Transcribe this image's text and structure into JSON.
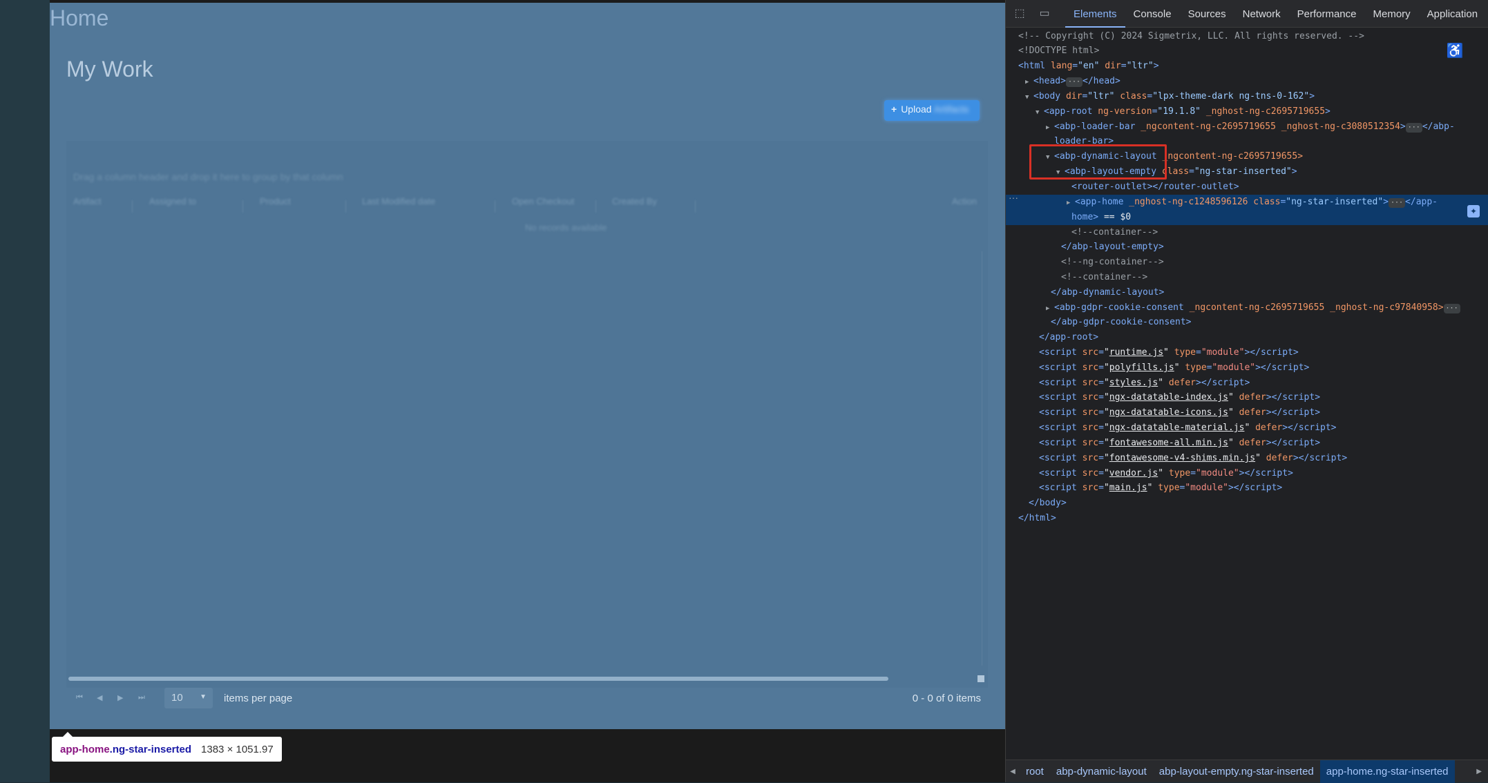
{
  "app": {
    "title": "Home",
    "subtitle": "My Work",
    "upload_label": "Upload",
    "upload_blurred": "Artifacts",
    "hint": "Drag a column header and drop it here to group by that column",
    "columns": [
      "Artifact",
      "Assigned to",
      "Product",
      "Last Modified date",
      "Open Checkout",
      "Created By",
      "Action"
    ],
    "no_records": "No records available",
    "pager": {
      "first_icon": "⏮",
      "prev_icon": "◀",
      "next_icon": "▶",
      "last_icon": "⏭",
      "page_size": "10",
      "items_per_page": "items per page",
      "range": "0 - 0 of 0 items"
    }
  },
  "tooltip": {
    "tag": "app-home",
    "cls": ".ng-star-inserted",
    "size": "1383 × 1051.97"
  },
  "devtools": {
    "tabs": [
      "Elements",
      "Console",
      "Sources",
      "Network",
      "Performance",
      "Memory",
      "Application"
    ],
    "active_tab": "Elements",
    "code": {
      "l1": "<!-- Copyright (C) 2024 Sigmetrix, LLC. All rights reserved. -->",
      "l2": "<!DOCTYPE html>",
      "html_tag": "html",
      "html_lang_attr": "lang",
      "html_lang_val": "\"en\"",
      "html_dir_attr": "dir",
      "html_dir_val": "\"ltr\"",
      "head_open": "<head>",
      "head_close": "</head>",
      "body_dir": "\"ltr\"",
      "body_class": "\"lpx-theme-dark ng-tns-0-162\"",
      "approot_ver": "\"19.1.8\"",
      "approot_host": "_nghost-ng-c2695719655",
      "loader": "<abp-loader-bar",
      "loader_attrs": "_ngcontent-ng-c2695719655 _nghost-ng-c3080512354",
      "loader_close1": "</abp-",
      "loader_close2": "loader-bar>",
      "dyn_tag": "<abp-dynamic-layout",
      "dyn_attr": "_ngcontent-ng-c2695719655>",
      "empty_tag": "<abp-layout-empty",
      "empty_class_val": "\"ng-star-inserted\"",
      "router": "<router-outlet></router-outlet>",
      "apphome_tag": "<app-home",
      "apphome_host": "_nghost-ng-c1248596126",
      "apphome_class_val": "\"ng-star-inserted\"",
      "apphome_close1": "</app-",
      "apphome_close2": "home>",
      "dollar0": "== $0",
      "c_container": "<!--container-->",
      "empty_close": "</abp-layout-empty>",
      "c_ngcontainer": "<!--ng-container-->",
      "dyn_close": "</abp-dynamic-layout>",
      "gdpr_tag": "<abp-gdpr-cookie-consent",
      "gdpr_attrs": "_ngcontent-ng-c2695719655 _nghost-ng-c97840958>",
      "gdpr_close": "</abp-gdpr-cookie-consent>",
      "approot_close": "</app-root>",
      "scripts": [
        {
          "src": "runtime.js",
          "extra_attr": "type",
          "extra_val": "\"module\""
        },
        {
          "src": "polyfills.js",
          "extra_attr": "type",
          "extra_val": "\"module\""
        },
        {
          "src": "styles.js",
          "extra_attr": "defer",
          "extra_val": ""
        },
        {
          "src": "ngx-datatable-index.js",
          "extra_attr": "defer",
          "extra_val": ""
        },
        {
          "src": "ngx-datatable-icons.js",
          "extra_attr": "defer",
          "extra_val": ""
        },
        {
          "src": "ngx-datatable-material.js",
          "extra_attr": "defer",
          "extra_val": ""
        },
        {
          "src": "fontawesome-all.min.js",
          "extra_attr": "defer",
          "extra_val": ""
        },
        {
          "src": "fontawesome-v4-shims.min.js",
          "extra_attr": "defer",
          "extra_val": ""
        },
        {
          "src": "vendor.js",
          "extra_attr": "type",
          "extra_val": "\"module\""
        },
        {
          "src": "main.js",
          "extra_attr": "type",
          "extra_val": "\"module\""
        }
      ],
      "body_close": "</body>",
      "html_close": "</html>"
    },
    "breadcrumbs": [
      "root",
      "abp-dynamic-layout",
      "abp-layout-empty.ng-star-inserted",
      "app-home.ng-star-inserted"
    ],
    "icons": {
      "inspect": "inspect-element-icon",
      "device": "device-toolbar-icon",
      "accessibility": "accessibility-icon"
    }
  }
}
